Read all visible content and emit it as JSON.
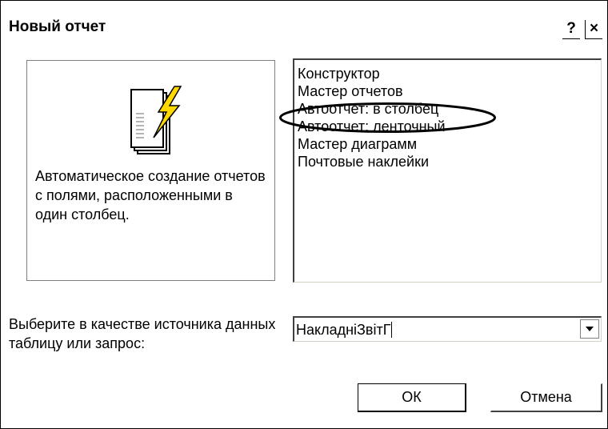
{
  "dialog": {
    "title": "Новый отчет",
    "help_label": "?",
    "close_label": "×"
  },
  "preview": {
    "icon": "report-wizard-icon",
    "description": "Автоматическое создание отчетов с полями, расположенными в один столбец."
  },
  "report_types": {
    "items": [
      "Конструктор",
      "Мастер отчетов",
      "Автоотчет: в столбец",
      "Автоотчет: ленточный",
      "Мастер диаграмм",
      "Почтовые наклейки"
    ],
    "selected_index": 2
  },
  "source": {
    "label": "Выберите в качестве источника данных таблицу или запрос:",
    "value": "НакладніЗвітГ"
  },
  "buttons": {
    "ok": "ОК",
    "cancel": "Отмена"
  }
}
